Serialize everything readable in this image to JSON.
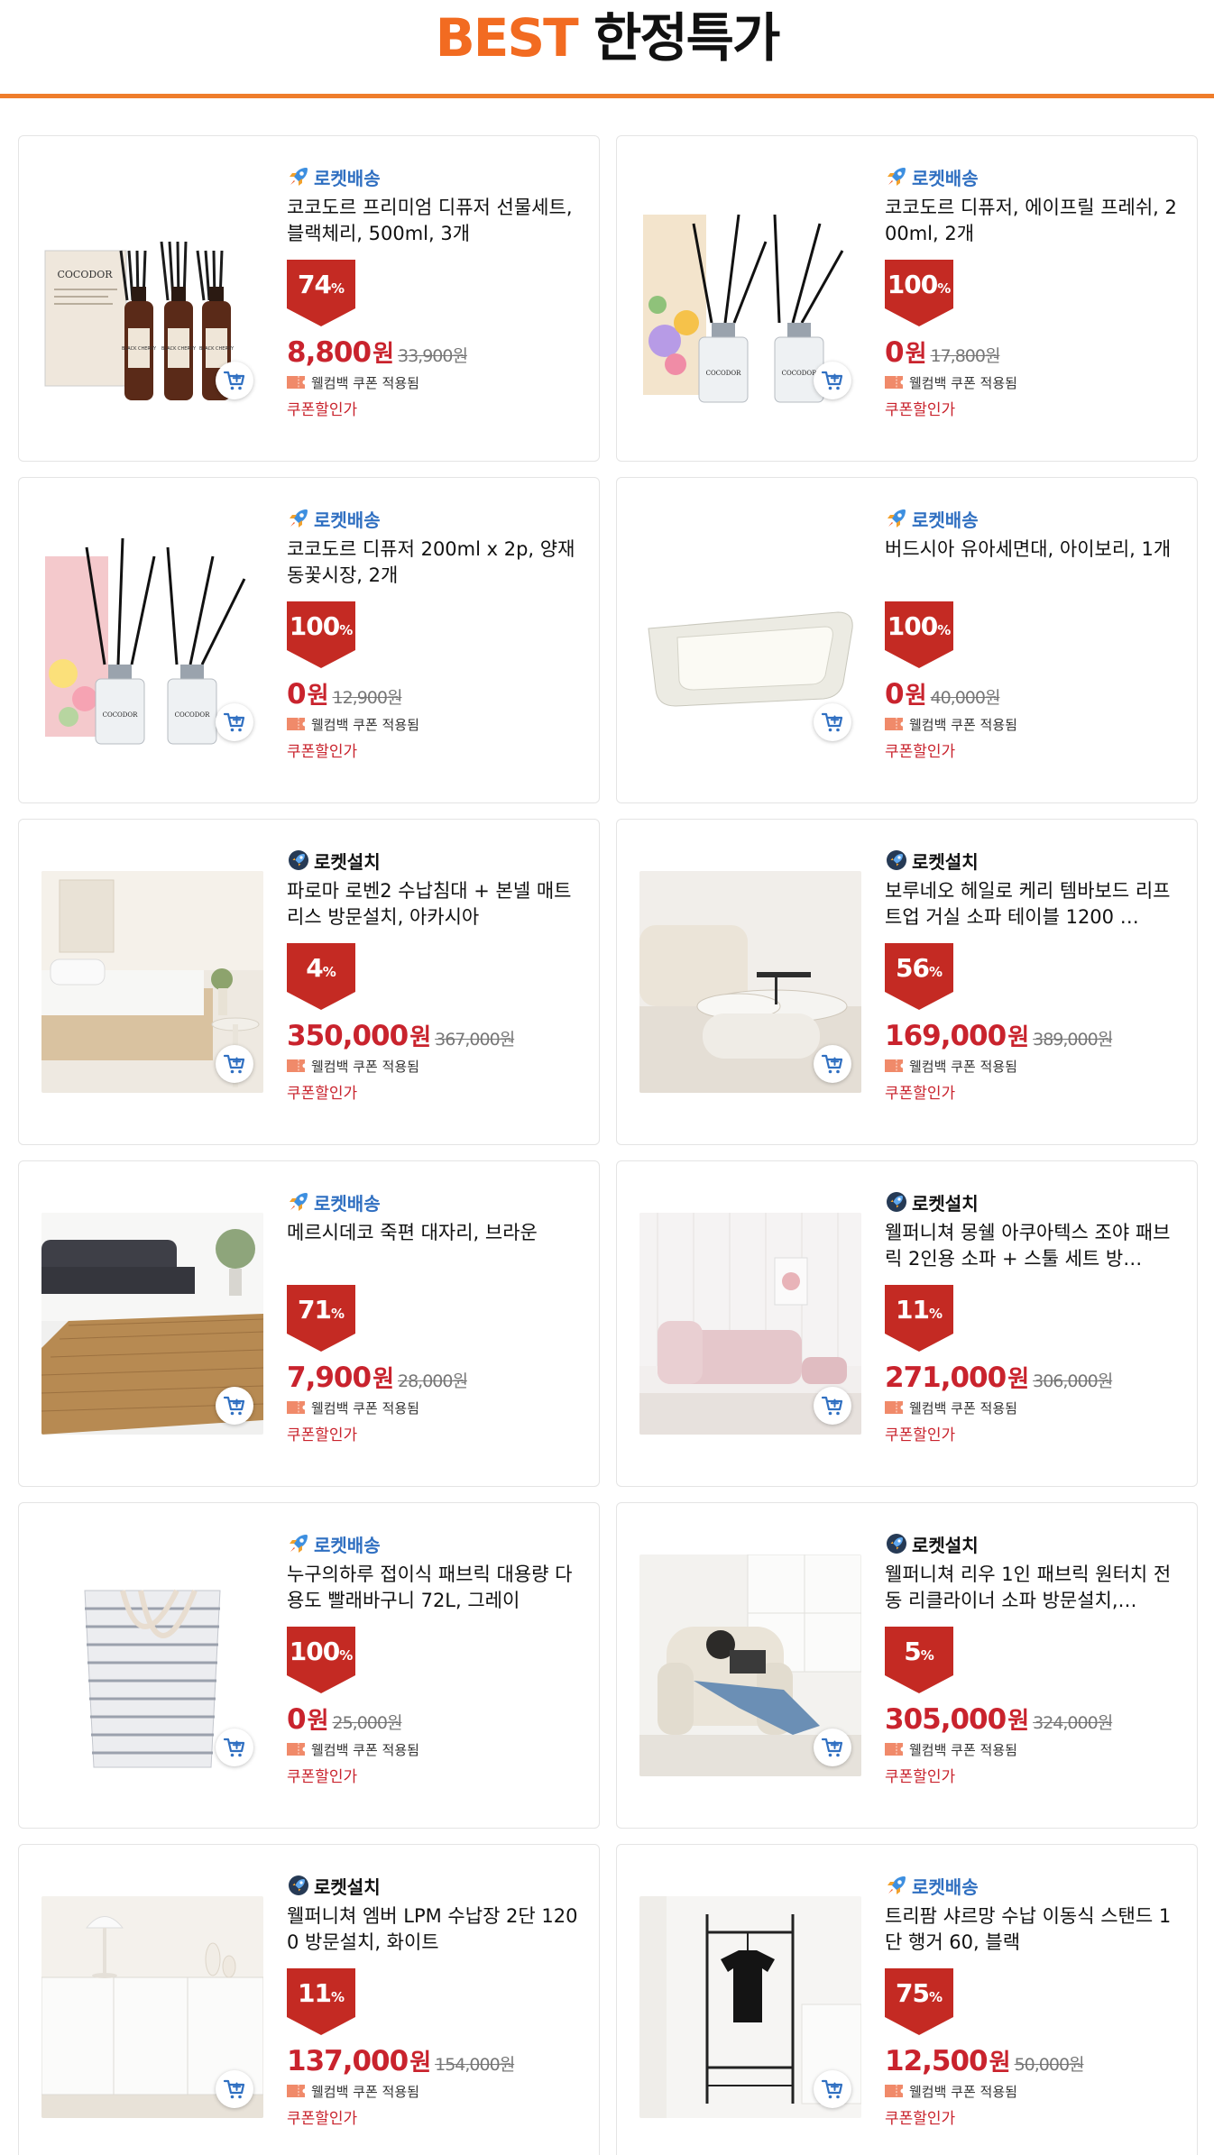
{
  "header": {
    "title_brand": "BEST",
    "title_rest": "한정특가"
  },
  "colors": {
    "accent": "#ef7d2b",
    "price": "#c9232d",
    "delivery": "#2f6fc1"
  },
  "products": [
    {
      "badge_type": "delivery",
      "badge": "로켓배송",
      "title": "코코도르 프리미엄 디퓨저 선물세트, 블랙체리, 500ml, 3개",
      "discount": "74",
      "price": "8,800",
      "won": "원",
      "original": "33,900원",
      "coupon": "웰컴백 쿠폰 적용됨",
      "coupon_sale": "쿠폰할인가",
      "image": "diffuser-black-cherry"
    },
    {
      "badge_type": "delivery",
      "badge": "로켓배송",
      "title": "코코도르 디퓨저, 에이프릴 프레쉬, 200ml, 2개",
      "discount": "100",
      "price": "0",
      "won": "원",
      "original": "17,800원",
      "coupon": "웰컴백 쿠폰 적용됨",
      "coupon_sale": "쿠폰할인가",
      "image": "diffuser-april-fresh"
    },
    {
      "badge_type": "delivery",
      "badge": "로켓배송",
      "title": "코코도르 디퓨저 200ml x 2p, 양재동꽃시장, 2개",
      "discount": "100",
      "price": "0",
      "won": "원",
      "original": "12,900원",
      "coupon": "웰컴백 쿠폰 적용됨",
      "coupon_sale": "쿠폰할인가",
      "image": "diffuser-flower-market"
    },
    {
      "badge_type": "delivery",
      "badge": "로켓배송",
      "title": "버드시아 유아세면대, 아이보리, 1개",
      "discount": "100",
      "price": "0",
      "won": "원",
      "original": "40,000원",
      "coupon": "웰컴백 쿠폰 적용됨",
      "coupon_sale": "쿠폰할인가",
      "image": "baby-washbasin"
    },
    {
      "badge_type": "install",
      "badge": "로켓설치",
      "title": "파로마 로벤2 수납침대 + 본넬 매트리스 방문설치, 아카시아",
      "discount": "4",
      "price": "350,000",
      "won": "원",
      "original": "367,000원",
      "coupon": "웰컴백 쿠폰 적용됨",
      "coupon_sale": "쿠폰할인가",
      "image": "storage-bed"
    },
    {
      "badge_type": "install",
      "badge": "로켓설치",
      "title": "보루네오 헤일로 케리 템바보드 리프트업 거실 소파 테이블 1200 …",
      "discount": "56",
      "price": "169,000",
      "won": "원",
      "original": "389,000원",
      "coupon": "웰컴백 쿠폰 적용됨",
      "coupon_sale": "쿠폰할인가",
      "image": "lift-table"
    },
    {
      "badge_type": "delivery",
      "badge": "로켓배송",
      "title": "메르시데코 죽편 대자리, 브라운",
      "discount": "71",
      "price": "7,900",
      "won": "원",
      "original": "28,000원",
      "coupon": "웰컴백 쿠폰 적용됨",
      "coupon_sale": "쿠폰할인가",
      "image": "bamboo-mat"
    },
    {
      "badge_type": "install",
      "badge": "로켓설치",
      "title": "웰퍼니쳐 몽쉘 아쿠아텍스 조야 패브릭 2인용 소파 + 스툴 세트 방…",
      "discount": "11",
      "price": "271,000",
      "won": "원",
      "original": "306,000원",
      "coupon": "웰컴백 쿠폰 적용됨",
      "coupon_sale": "쿠폰할인가",
      "image": "pink-sofa"
    },
    {
      "badge_type": "delivery",
      "badge": "로켓배송",
      "title": "누구의하루 접이식 패브릭 대용량 다용도 빨래바구니 72L, 그레이",
      "discount": "100",
      "price": "0",
      "won": "원",
      "original": "25,000원",
      "coupon": "웰컴백 쿠폰 적용됨",
      "coupon_sale": "쿠폰할인가",
      "image": "laundry-basket"
    },
    {
      "badge_type": "install",
      "badge": "로켓설치",
      "title": "웰퍼니쳐 리우 1인 패브릭 원터치 전동 리클라이너 소파 방문설치,…",
      "discount": "5",
      "price": "305,000",
      "won": "원",
      "original": "324,000원",
      "coupon": "웰컴백 쿠폰 적용됨",
      "coupon_sale": "쿠폰할인가",
      "image": "recliner"
    },
    {
      "badge_type": "install",
      "badge": "로켓설치",
      "title": "웰퍼니쳐 엠버 LPM 수납장 2단 1200 방문설치, 화이트",
      "discount": "11",
      "price": "137,000",
      "won": "원",
      "original": "154,000원",
      "coupon": "웰컴백 쿠폰 적용됨",
      "coupon_sale": "쿠폰할인가",
      "image": "white-cabinet"
    },
    {
      "badge_type": "delivery",
      "badge": "로켓배송",
      "title": "트리팜 샤르망 수납 이동식 스탠드 1단 행거 60, 블랙",
      "discount": "75",
      "price": "12,500",
      "won": "원",
      "original": "50,000원",
      "coupon": "웰컴백 쿠폰 적용됨",
      "coupon_sale": "쿠폰할인가",
      "image": "hanger-stand"
    }
  ]
}
